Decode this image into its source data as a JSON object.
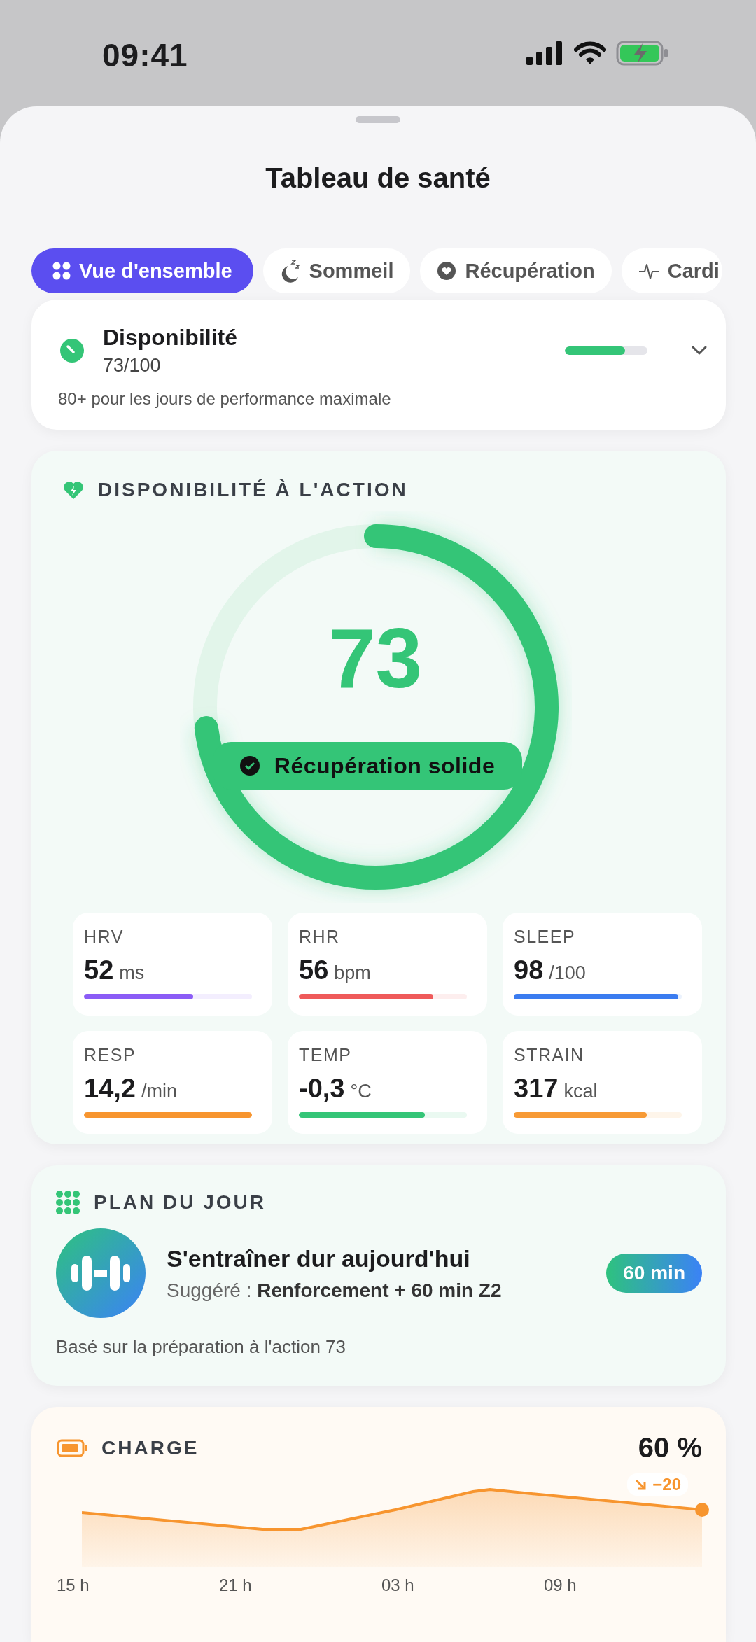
{
  "status_bar": {
    "time": "09:41"
  },
  "title": "Tableau de santé",
  "tabs": [
    {
      "label": "Vue d'ensemble",
      "kind": "overview",
      "selected": true
    },
    {
      "label": "Sommeil",
      "kind": "sleep",
      "selected": false
    },
    {
      "label": "Récupération",
      "kind": "recovery",
      "selected": false
    },
    {
      "label": "Cardi",
      "kind": "cardio",
      "selected": false
    }
  ],
  "summary": {
    "title": "Disponibilité",
    "value": "73/100",
    "level": 0.73,
    "note": "80+ pour les jours de performance maximale"
  },
  "readiness": {
    "heading": "DISPONIBILITÉ À L'ACTION",
    "score": "73",
    "level": 0.73,
    "status": "Récupération solide",
    "metrics": [
      {
        "label": "HRV",
        "value": "52",
        "unit": "ms",
        "level": 0.65,
        "color": "#8b5cf6"
      },
      {
        "label": "RHR",
        "value": "56",
        "unit": "bpm",
        "level": 0.8,
        "color": "#ef5a5a"
      },
      {
        "label": "SLEEP",
        "value": "98",
        "unit": "/100",
        "level": 0.98,
        "color": "#3b7cf0"
      },
      {
        "label": "RESP",
        "value": "14,2",
        "unit": "/min",
        "level": 1,
        "color": "#f7952f"
      },
      {
        "label": "TEMP",
        "value": "-0,3",
        "unit": "°C",
        "level": 0.75,
        "color": "#34c577"
      },
      {
        "label": "STRAIN",
        "value": "317",
        "unit": "kcal",
        "level": 0.79,
        "color": "#f79a35"
      }
    ]
  },
  "plan": {
    "heading": "PLAN DU JOUR",
    "title": "S'entraîner dur aujourd'hui",
    "suggestion_label": "Suggéré :",
    "suggestion": "Renforcement + 60 min Z2",
    "duration": "60 min",
    "note": "Basé sur la préparation à l'action 73"
  },
  "charge": {
    "heading": "CHARGE",
    "value": "60 %",
    "delta": "−20",
    "x_labels": [
      "15 h",
      "21 h",
      "03 h",
      "09 h"
    ]
  }
}
